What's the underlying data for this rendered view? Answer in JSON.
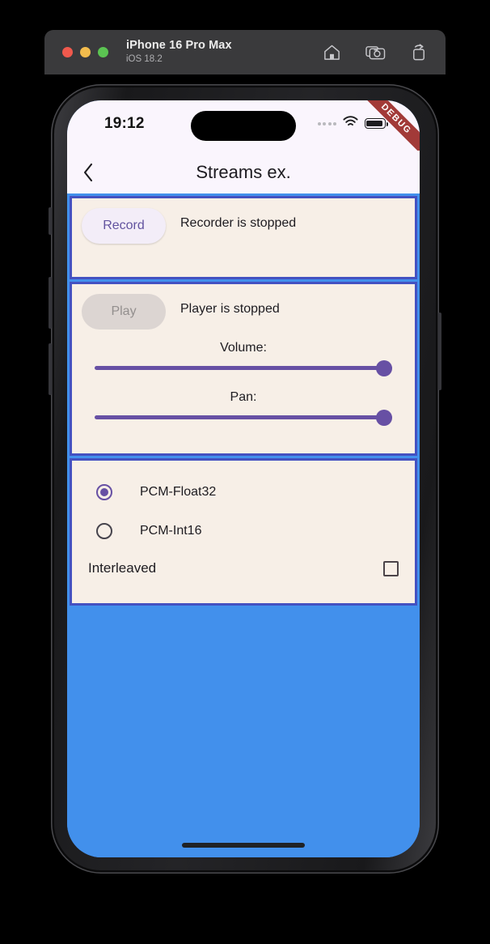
{
  "simulator": {
    "device_name": "iPhone 16 Pro Max",
    "os_version": "iOS 18.2",
    "window_controls": [
      "close-button",
      "minimize-button",
      "zoom-button"
    ],
    "actions": [
      {
        "name": "home-icon",
        "label": "Home"
      },
      {
        "name": "screenshot-icon",
        "label": "Screenshot"
      },
      {
        "name": "rotate-icon",
        "label": "Rotate"
      }
    ]
  },
  "status_bar": {
    "time": "19:12",
    "cellular": "····",
    "wifi": "wifi-icon",
    "battery": "battery-icon"
  },
  "debug_ribbon": {
    "label": "DEBUG",
    "color": "#A23A38"
  },
  "app_bar": {
    "back_icon": "chevron-left-icon",
    "title": "Streams ex."
  },
  "recorder": {
    "button_label": "Record",
    "button_enabled": true,
    "status": "Recorder is stopped"
  },
  "player": {
    "button_label": "Play",
    "button_enabled": false,
    "status": "Player is stopped",
    "volume": {
      "label": "Volume:",
      "value": 100,
      "min": 0,
      "max": 100
    },
    "pan": {
      "label": "Pan:",
      "value": 100,
      "min": 0,
      "max": 100
    }
  },
  "format_options": {
    "radios": [
      {
        "label": "PCM-Float32",
        "selected": true
      },
      {
        "label": "PCM-Int16",
        "selected": false
      }
    ],
    "interleaved": {
      "label": "Interleaved",
      "checked": false
    }
  },
  "theme": {
    "background": "#4290EC",
    "card_background": "#F7EFE7",
    "card_border": "#4451C1",
    "accent": "#6750A4",
    "status_bar_background": "#FAF5FD"
  }
}
